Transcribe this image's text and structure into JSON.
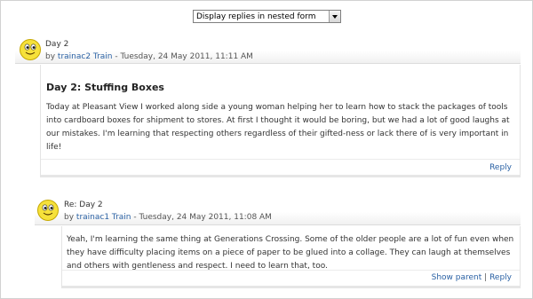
{
  "display_mode": {
    "selected": "Display replies in nested form"
  },
  "posts": [
    {
      "subject": "Day 2",
      "by": "by",
      "author": "trainac2 Train",
      "date": " - Tuesday, 24 May 2011, 11:11 AM",
      "title": "Day 2: Stuffing Boxes",
      "message": "Today at Pleasant View I worked along side a young woman helping her to learn how to stack the packages of tools into cardboard boxes for shipment to stores. At first I thought it would be boring, but we had a lot of good laughs at our mistakes. I'm learning that respecting others regardless of their gifted-ness or lack there of is very important in life!",
      "commands": {
        "reply": "Reply"
      }
    },
    {
      "subject": "Re: Day 2",
      "by": "by",
      "author": "trainac1 Train",
      "date": " - Tuesday, 24 May 2011, 11:08 AM",
      "message": "Yeah, I'm learning the same thing at Generations Crossing. Some of the older people are a lot of fun even when they have difficulty placing items on a piece of paper to be glued into a collage. They can laugh at themselves and others with gentleness and respect. I need to learn that, too.",
      "commands": {
        "show_parent": "Show parent",
        "separator": "|",
        "reply": "Reply"
      }
    }
  ],
  "colors": {
    "link": "#2a61a4",
    "header_fade": "#f1f1f1",
    "smiley_face": "#f6e13a"
  }
}
